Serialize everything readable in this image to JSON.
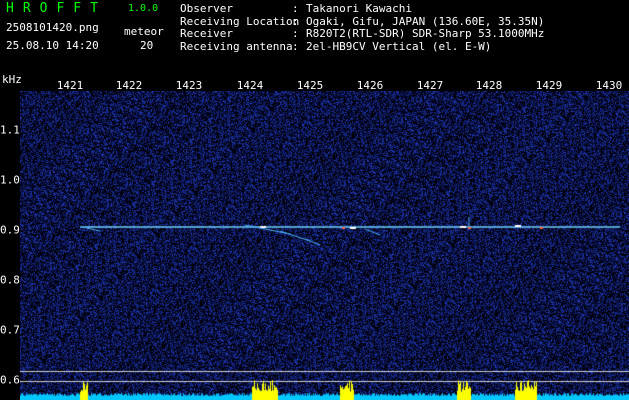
{
  "app": {
    "title": "HROFFT",
    "version": "1.0.0",
    "filename": "2508101420.png",
    "datetime": "25.08.10 14:20",
    "meteor_label": "meteor",
    "meteor_count": "20"
  },
  "info": [
    {
      "label": "Observer",
      "sep": ":",
      "value": "Takanori Kawachi"
    },
    {
      "label": "Receiving Location",
      "sep": ":",
      "value": "Ogaki, Gifu, JAPAN (136.60E, 35.35N)"
    },
    {
      "label": "Receiver",
      "sep": ":",
      "value": "R820T2(RTL-SDR) SDR-Sharp 53.1000MHz"
    },
    {
      "label": "Receiving antenna",
      "sep": ":",
      "value": "2el-HB9CV Vertical (el. E-W)"
    }
  ],
  "axis": {
    "unit": "kHz",
    "x_ticks": [
      "1421",
      "1422",
      "1423",
      "1424",
      "1425",
      "1426",
      "1427",
      "1428",
      "1429",
      "1430"
    ],
    "y_ticks": [
      "1.1",
      "1.0",
      "0.9",
      "0.8",
      "0.7",
      "0.6"
    ]
  },
  "colors": {
    "title": "#00ff00",
    "background": "#000000",
    "noise": "#1a2a80",
    "trace": "#6fd0ff",
    "spectrum": "#00c8ff",
    "peak": "#ffff00"
  }
}
